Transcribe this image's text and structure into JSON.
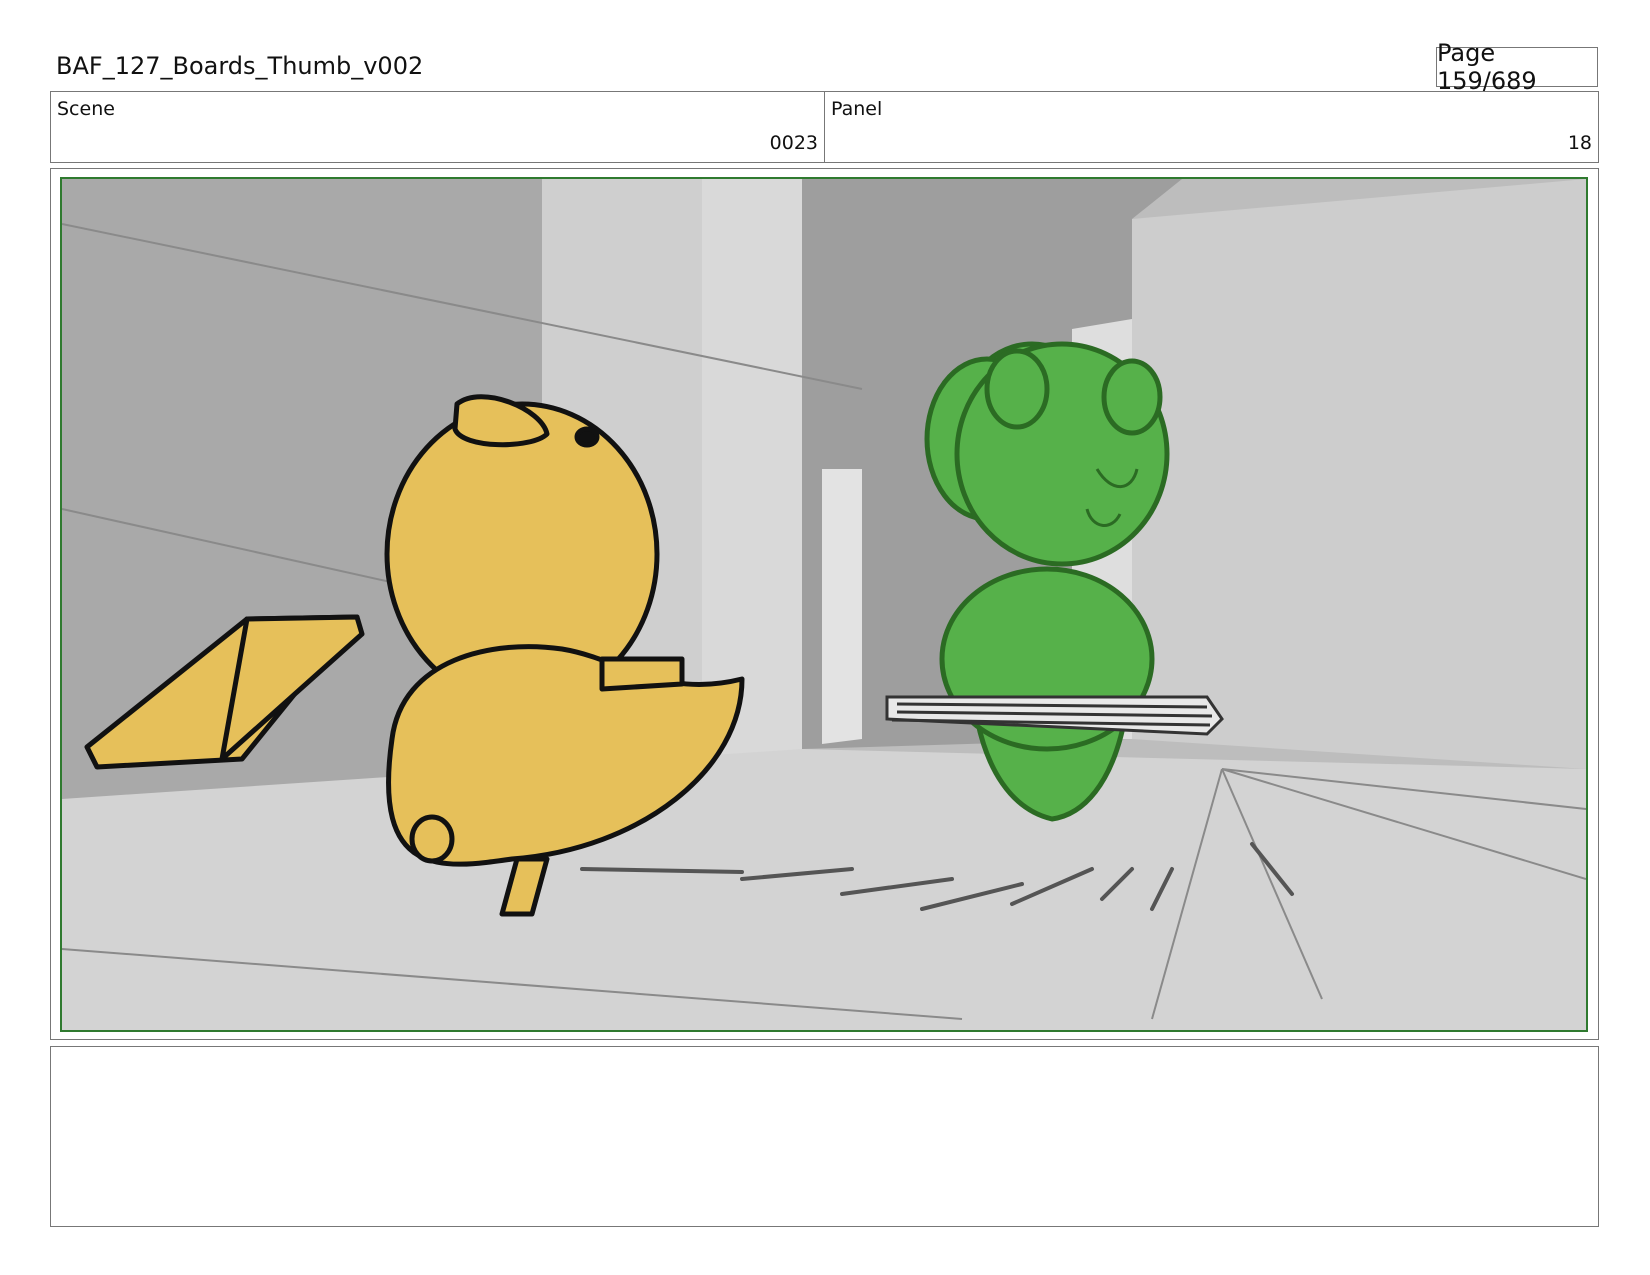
{
  "header": {
    "title": "BAF_127_Boards_Thumb_v002",
    "page": "Page 159/689"
  },
  "info": {
    "scene_label": "Scene",
    "scene_value": "0023",
    "panel_label": "Panel",
    "panel_value": "18"
  },
  "panel_image": {
    "description_icon": "storyboard-sketch",
    "frame_color": "#2f7a2f",
    "yellow_character_color": "#e6c05a",
    "green_character_color": "#56b14a"
  },
  "notes": {
    "text": ""
  }
}
